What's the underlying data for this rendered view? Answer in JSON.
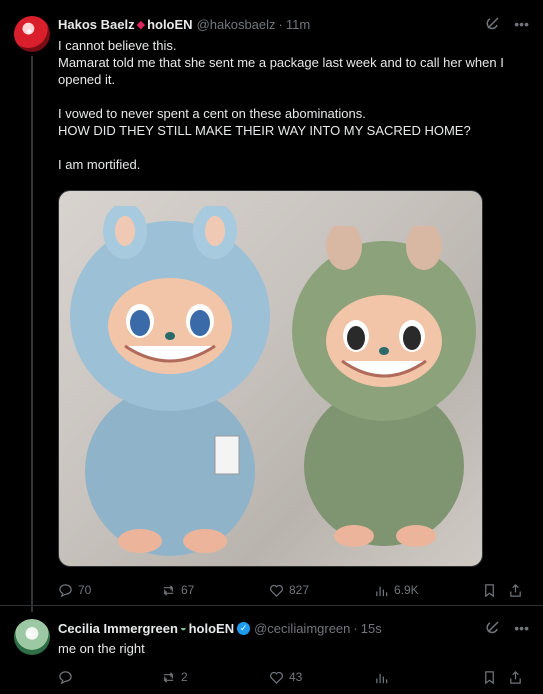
{
  "tweet1": {
    "author_name": "Hakos Baelz",
    "author_badge_text": "holoEN",
    "handle": "@hakosbaelz",
    "separator": "·",
    "time": "11m",
    "lines": [
      "I cannot believe this.",
      "Mamarat told me that she sent me a package last week and to call her when I opened it.",
      "",
      "I vowed to never spent a cent on these abominations.",
      "HOW DID THEY STILL MAKE THEIR WAY INTO MY SACRED HOME?",
      "",
      "I am mortified."
    ],
    "stats": {
      "replies": "70",
      "reposts": "67",
      "likes": "827",
      "views": "6.9K"
    }
  },
  "tweet2": {
    "author_name": "Cecilia Immergreen",
    "author_badge_text": "holoEN",
    "handle": "@ceciliaimgreen",
    "separator": "·",
    "time": "15s",
    "text": "me on the right",
    "stats": {
      "replies": "",
      "reposts": "2",
      "likes": "43",
      "views": ""
    }
  },
  "icons": [
    "grok-icon",
    "more-icon",
    "reply-icon",
    "repost-icon",
    "like-icon",
    "views-icon",
    "bookmark-icon",
    "share-icon"
  ],
  "colors": {
    "background": "#000000",
    "text": "#e7e9ea",
    "muted": "#71767b",
    "verified": "#1d9bf0",
    "divider": "#2f3336"
  }
}
